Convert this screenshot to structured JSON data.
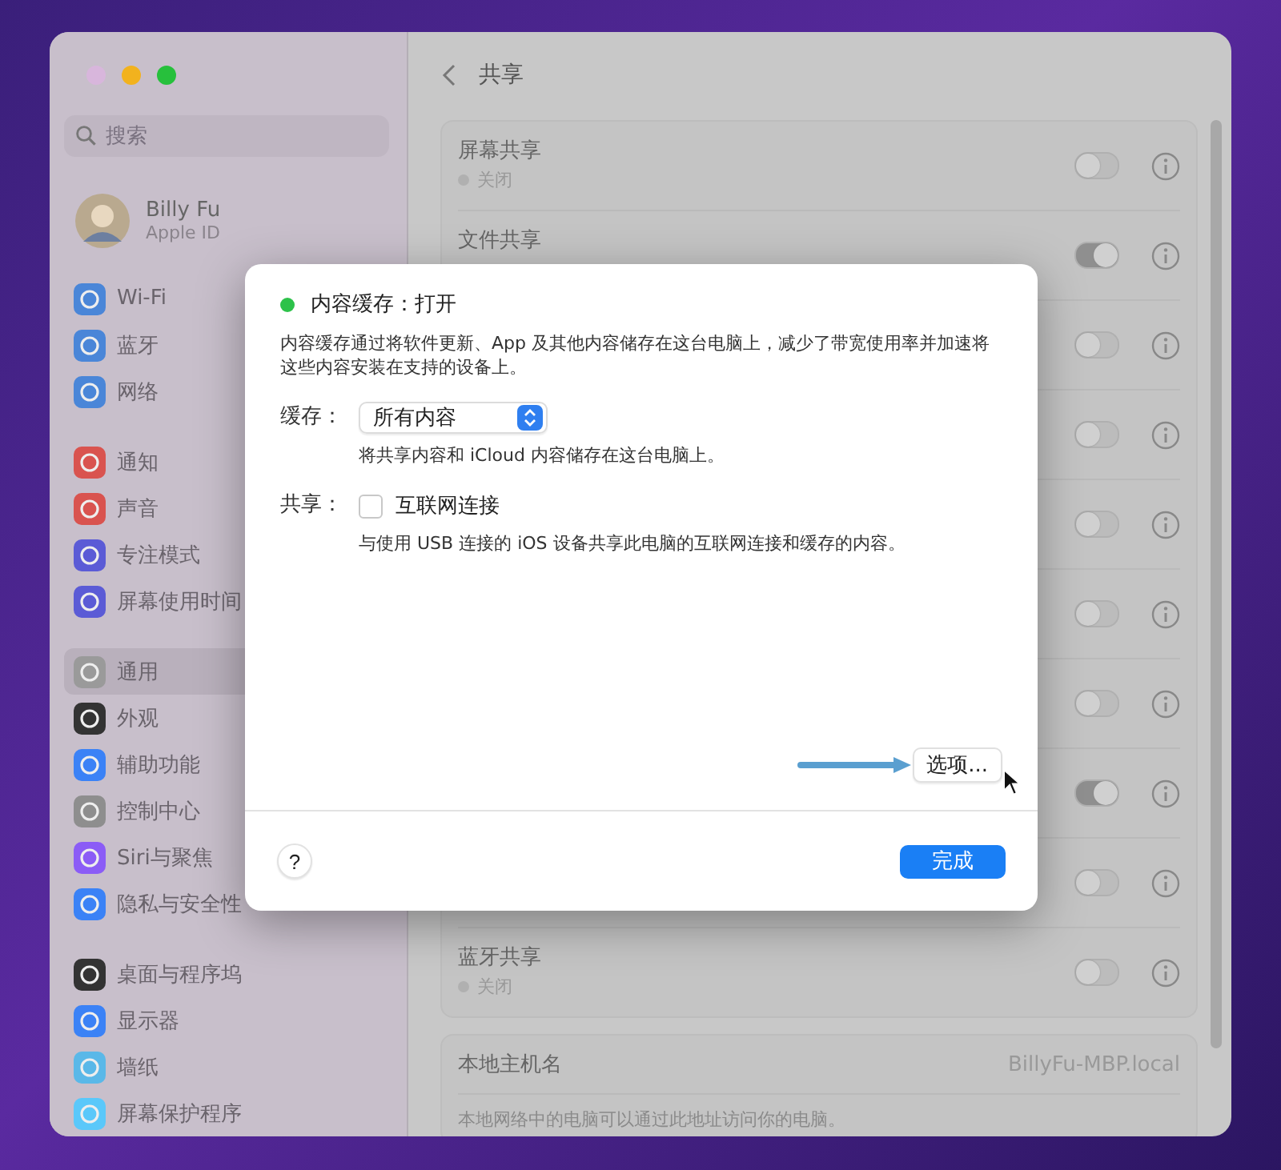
{
  "sidebar": {
    "search": {
      "placeholder": "搜索"
    },
    "account": {
      "name": "Billy Fu",
      "subtitle": "Apple ID"
    },
    "groups": [
      {
        "items": [
          {
            "label": "Wi-Fi",
            "color": "#4a86d8",
            "selected": false
          },
          {
            "label": "蓝牙",
            "color": "#4a86d8",
            "selected": false
          },
          {
            "label": "网络",
            "color": "#4a86d8",
            "selected": false
          }
        ]
      },
      {
        "items": [
          {
            "label": "通知",
            "color": "#d9534f",
            "selected": false
          },
          {
            "label": "声音",
            "color": "#d9534f",
            "selected": false
          },
          {
            "label": "专注模式",
            "color": "#5b5bd6",
            "selected": false
          },
          {
            "label": "屏幕使用时间",
            "color": "#5b5bd6",
            "selected": false
          }
        ]
      },
      {
        "items": [
          {
            "label": "通用",
            "color": "#9a9a9a",
            "selected": true
          },
          {
            "label": "外观",
            "color": "#333333",
            "selected": false
          },
          {
            "label": "辅助功能",
            "color": "#3b82f6",
            "selected": false
          },
          {
            "label": "控制中心",
            "color": "#8e8e8e",
            "selected": false
          },
          {
            "label": "Siri与聚焦",
            "color": "#8b5cf6",
            "selected": false
          },
          {
            "label": "隐私与安全性",
            "color": "#3b82f6",
            "selected": false
          }
        ]
      },
      {
        "items": [
          {
            "label": "桌面与程序坞",
            "color": "#333333",
            "selected": false
          },
          {
            "label": "显示器",
            "color": "#3b82f6",
            "selected": false
          },
          {
            "label": "墙纸",
            "color": "#5ab8e8",
            "selected": false
          },
          {
            "label": "屏幕保护程序",
            "color": "#5ac8fa",
            "selected": false
          }
        ]
      }
    ]
  },
  "content": {
    "title": "共享",
    "services": [
      {
        "label": "屏幕共享",
        "status": "关闭",
        "on": false
      },
      {
        "label": "文件共享",
        "on": true
      },
      {
        "on": false
      },
      {
        "on": false
      },
      {
        "on": false
      },
      {
        "on": false
      },
      {
        "on": false
      },
      {
        "on": true
      },
      {
        "on": false
      },
      {
        "label": "蓝牙共享",
        "status": "关闭",
        "on": false
      }
    ],
    "hostname": {
      "label": "本地主机名",
      "value": "BillyFu-MBP.local",
      "note": "本地网络中的电脑可以通过此地址访问你的电脑。"
    }
  },
  "dialog": {
    "title": "内容缓存：打开",
    "on": true,
    "description": "内容缓存通过将软件更新、App 及其他内容储存在这台电脑上，减少了带宽使用率并加速将这些内容安装在支持的设备上。",
    "cache": {
      "label": "缓存：",
      "value": "所有内容",
      "hint": "将共享内容和 iCloud 内容储存在这台电脑上。"
    },
    "share": {
      "label": "共享：",
      "option": "互联网连接",
      "checked": false,
      "hint": "与使用 USB 连接的 iOS 设备共享此电脑的互联网连接和缓存的内容。"
    },
    "options_button": "选项...",
    "help_button": "?",
    "done_button": "完成"
  }
}
